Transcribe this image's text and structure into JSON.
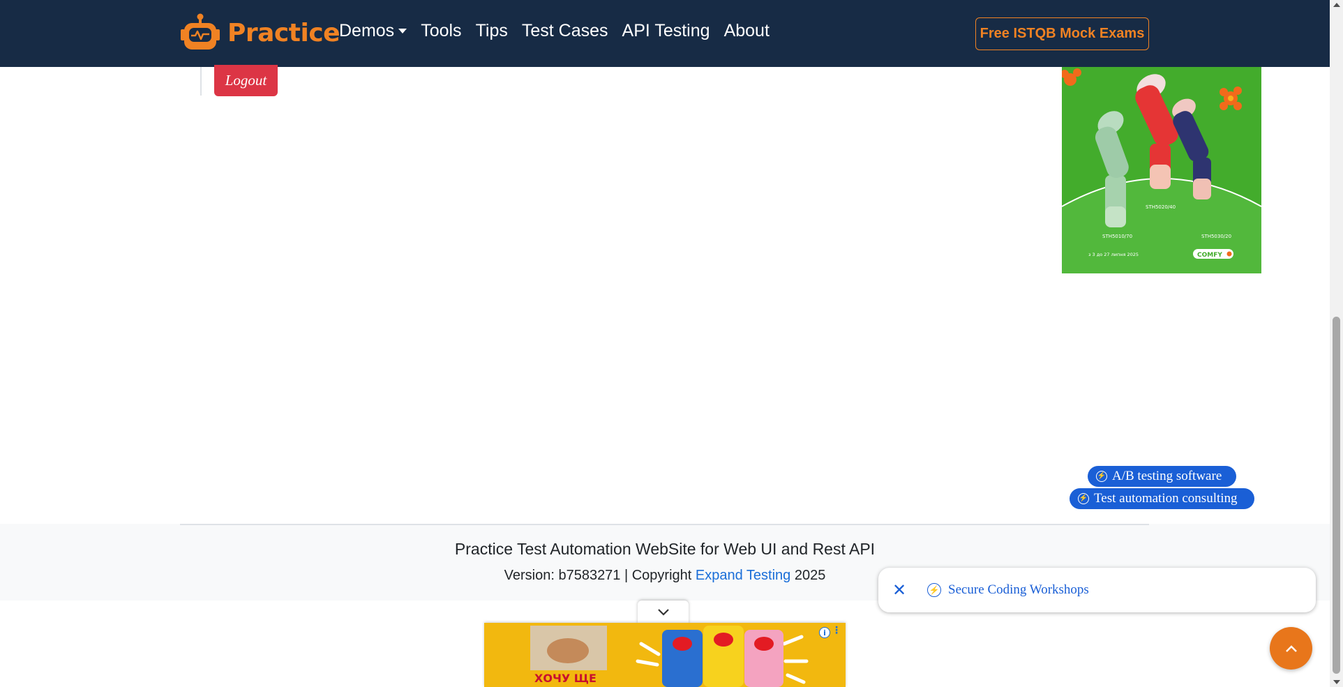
{
  "navbar": {
    "brand": "Practice",
    "links": [
      "Demos",
      "Tools",
      "Tips",
      "Test Cases",
      "API Testing",
      "About"
    ],
    "cta": "Free ISTQB Mock Exams"
  },
  "main": {
    "logout_label": "Logout"
  },
  "ad_right": {
    "models": [
      "STH5010/70",
      "STH5020/40",
      "STH5030/20"
    ],
    "dates": "з 3 до 27 липня 2025",
    "brand": "COMFY"
  },
  "sponsored_pills": [
    "A/B testing software",
    "Test automation consulting"
  ],
  "footer": {
    "title": "Practice Test Automation WebSite for Web UI and Rest API",
    "version_prefix": "Version: b7583271 | Copyright ",
    "company": "Expand Testing",
    "year": " 2025"
  },
  "floating_card": {
    "link": "Secure Coding Workshops"
  },
  "ad_bottom": {
    "text": "ХОЧУ ЩЕ"
  },
  "colors": {
    "navbar_bg": "#172b45",
    "brand": "#f08223",
    "danger": "#dc3545",
    "link": "#1a6ed8",
    "ad_green": "#43ac2c"
  }
}
